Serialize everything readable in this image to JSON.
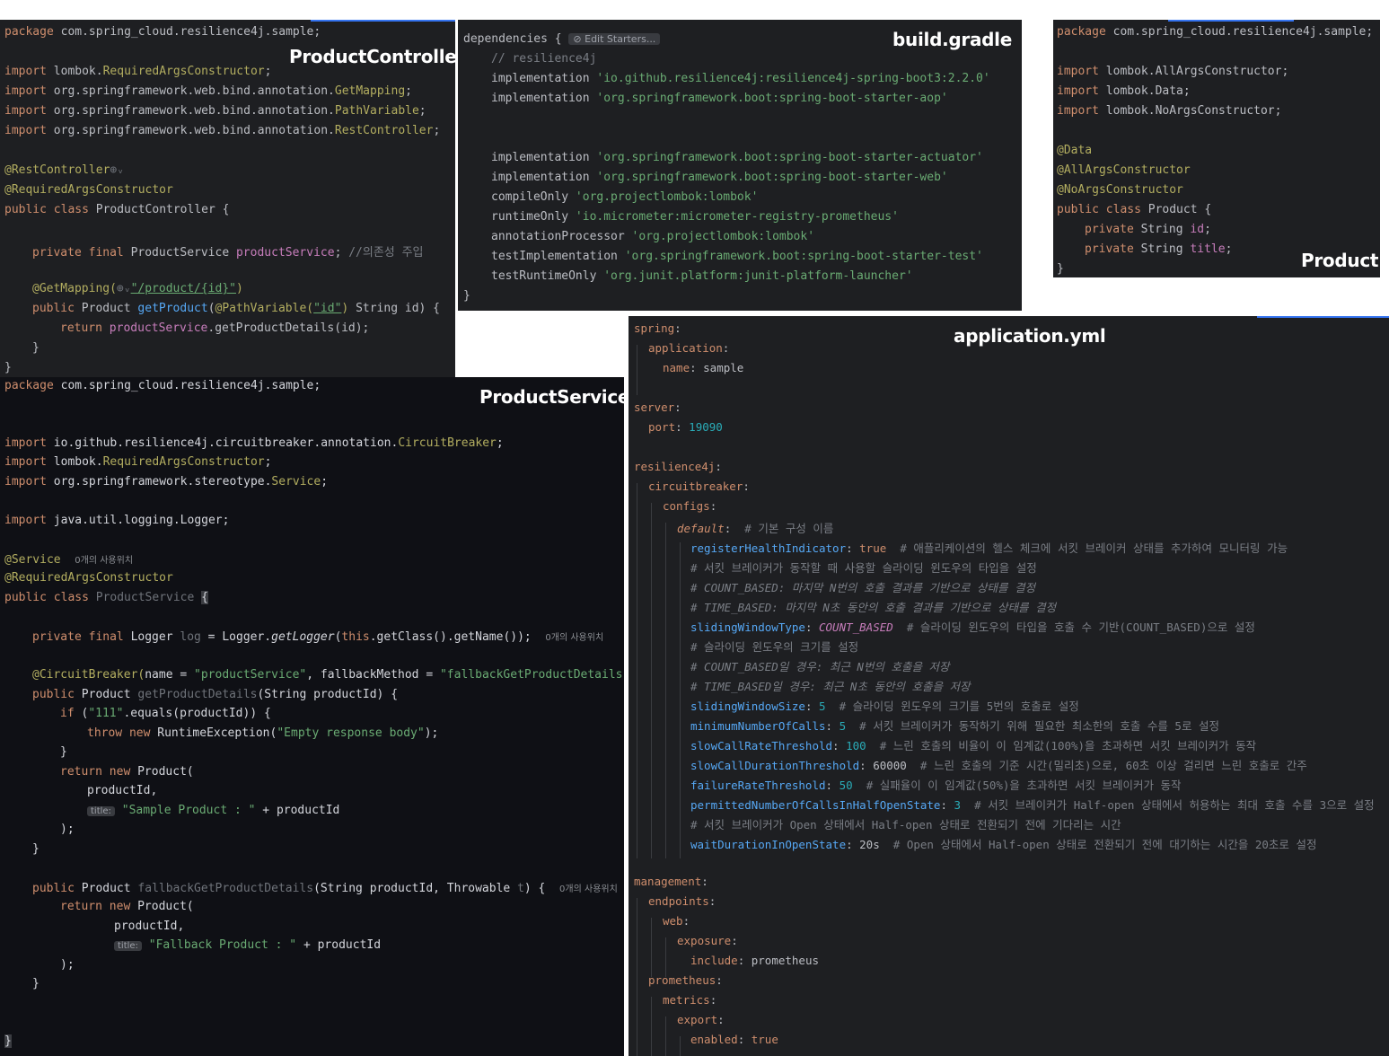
{
  "panels": {
    "controller": {
      "title": "ProductController",
      "lines": {
        "l01a": "package",
        "l01b": " com.spring_cloud.resilience4j.sample;",
        "l02a": "import",
        "l02b": " lombok.",
        "l02c": "RequiredArgsConstructor",
        "l02d": ";",
        "l03a": "import",
        "l03b": " org.springframework.web.bind.annotation.",
        "l03c": "GetMapping",
        "l03d": ";",
        "l04a": "import",
        "l04b": " org.springframework.web.bind.annotation.",
        "l04c": "PathVariable",
        "l04d": ";",
        "l05a": "import",
        "l05b": " org.springframework.web.bind.annotation.",
        "l05c": "RestController",
        "l05d": ";",
        "l06a": "@RestController",
        "l06b": "⊕ᵥ",
        "l07a": "@RequiredArgsConstructor",
        "l08a": "public class",
        "l08b": " ProductController {",
        "l09a": "private final",
        "l09b": " ProductService ",
        "l09c": "productService",
        "l09d": "; ",
        "l09e": "//의존성 주입",
        "l10a": "@GetMapping(",
        "l10b": "⊕ᵥ",
        "l10c": "\"/product/{id}\"",
        "l10d": ")",
        "l11a": "public",
        "l11b": " Product ",
        "l11c": "getProduct",
        "l11d": "(",
        "l11e": "@PathVariable(",
        "l11f": "\"id\"",
        "l11g": ")",
        "l11h": " String id) {",
        "l12a": "return",
        "l12b": " productService",
        "l12c": ".getProductDetails(id);",
        "l13a": "}",
        "l14a": "}"
      }
    },
    "gradle": {
      "title": "build.gradle",
      "edit_starters": "Edit Starters...",
      "lines": {
        "g01a": "dependencies {",
        "g02a": "// resilience4j",
        "g03a": "implementation",
        "g03b": "'io.github.resilience4j:resilience4j-spring-boot3:2.2.0'",
        "g04a": "implementation",
        "g04b": "'org.springframework.boot:spring-boot-starter-aop'",
        "g05a": "implementation",
        "g05b": "'org.springframework.boot:spring-boot-starter-actuator'",
        "g06a": "implementation",
        "g06b": "'org.springframework.boot:spring-boot-starter-web'",
        "g07a": "compileOnly",
        "g07b": "'org.projectlombok:lombok'",
        "g08a": "runtimeOnly",
        "g08b": "'io.micrometer:micrometer-registry-prometheus'",
        "g09a": "annotationProcessor",
        "g09b": "'org.projectlombok:lombok'",
        "g10a": "testImplementation",
        "g10b": "'org.springframework.boot:spring-boot-starter-test'",
        "g11a": "testRuntimeOnly",
        "g11b": "'org.junit.platform:junit-platform-launcher'",
        "g12a": "}"
      }
    },
    "product": {
      "title": "Product",
      "lines": {
        "p01a": "package",
        "p01b": " com.spring_cloud.resilience4j.sample;",
        "p02a": "import",
        "p02b": " lombok.AllArgsConstructor;",
        "p03a": "import",
        "p03b": " lombok.Data;",
        "p04a": "import",
        "p04b": " lombok.NoArgsConstructor;",
        "p05a": "@Data",
        "p06a": "@AllArgsConstructor",
        "p07a": "@NoArgsConstructor",
        "p08a": "public class",
        "p08b": " Product {",
        "p09a": "private",
        "p09b": " String ",
        "p09c": "id",
        "p09d": ";",
        "p10a": "private",
        "p10b": " String ",
        "p10c": "title",
        "p10d": ";",
        "p11a": "}"
      }
    },
    "service": {
      "title": "ProductService",
      "lines": {
        "s01a": "package",
        "s01b": " com.spring_cloud.resilience4j.sample;",
        "s02a": "import",
        "s02b": " io.github.resilience4j.circuitbreaker.annotation.",
        "s02c": "CircuitBreaker",
        "s02d": ";",
        "s03a": "import",
        "s03b": " lombok.",
        "s03c": "RequiredArgsConstructor",
        "s03d": ";",
        "s04a": "import",
        "s04b": " org.springframework.stereotype.",
        "s04c": "Service",
        "s04d": ";",
        "s05a": "import",
        "s05b": " java.util.logging.Logger;",
        "s06a": "@Service",
        "s06b": "0개의 사용위치",
        "s07a": "@RequiredArgsConstructor",
        "s08a": "public class",
        "s08b": " ProductService ",
        "s08c": "{",
        "s09a": "private final",
        "s09b": " Logger ",
        "s09c": "log",
        "s09d": " = Logger.",
        "s09e": "getLogger",
        "s09f": "(",
        "s09g": "this",
        "s09h": ".getClass().getName());",
        "s09i": "0개의 사용위치",
        "s10a": "@CircuitBreaker(",
        "s10b": "name = ",
        "s10c": "\"productService\"",
        "s10d": ", fallbackMethod = ",
        "s10e": "\"fallbackGetProductDetails\"",
        "s10f": ")",
        "s11a": "public",
        "s11b": " Product ",
        "s11c": "getProductDetails",
        "s11d": "(String productId) {",
        "s12a": "if",
        "s12b": " (",
        "s12c": "\"111\"",
        "s12d": ".equals(productId)) {",
        "s13a": "throw new",
        "s13b": " RuntimeException(",
        "s13c": "\"Empty response body\"",
        "s13d": ");",
        "s14a": "}",
        "s15a": "return new",
        "s15b": " Product(",
        "s16a": "productId,",
        "s17a": "title:",
        "s17b": "\"Sample Product : \"",
        "s17c": " + productId",
        "s18a": ");",
        "s19a": "}",
        "s20a": "public",
        "s20b": " Product ",
        "s20c": "fallbackGetProductDetails",
        "s20d": "(String productId, Throwable ",
        "s20e": "t",
        "s20f": ") {",
        "s20g": "0개의 사용위치",
        "s21a": "return new",
        "s21b": " Product(",
        "s22a": "productId,",
        "s23a": "title:",
        "s23b": "\"Fallback Product : \"",
        "s23c": " + productId",
        "s24a": ");",
        "s25a": "}",
        "s26a": "}"
      }
    },
    "yaml": {
      "title": "application.yml",
      "lines": {
        "y01a": "spring",
        "y01b": ":",
        "y02a": "application",
        "y02b": ":",
        "y03a": "name",
        "y03b": ": sample",
        "y04a": "server",
        "y04b": ":",
        "y05a": "port",
        "y05b": ": ",
        "y05c": "19090",
        "y06a": "resilience4j",
        "y06b": ":",
        "y07a": "circuitbreaker",
        "y07b": ":",
        "y08a": "configs",
        "y08b": ":",
        "y09a": "default",
        "y09b": ":  ",
        "y09c": "# 기본 구성 이름",
        "y10a": "registerHealthIndicator",
        "y10b": ": ",
        "y10c": "true",
        "y10d": "  # 애플리케이션의 헬스 체크에 서킷 브레이커 상태를 추가하여 모니터링 가능",
        "y11a": "# 서킷 브레이커가 동작할 때 사용할 슬라이딩 윈도우의 타입을 설정",
        "y12a": "# COUNT_BASED: 마지막 N번의 호출 결과를 기반으로 상태를 결정",
        "y13a": "# TIME_BASED: 마지막 N초 동안의 호출 결과를 기반으로 상태를 결정",
        "y14a": "slidingWindowType",
        "y14b": ": ",
        "y14c": "COUNT_BASED",
        "y14d": "  # 슬라이딩 윈도우의 타입을 호출 수 기반(COUNT_BASED)으로 설정",
        "y15a": "# 슬라이딩 윈도우의 크기를 설정",
        "y16a": "# COUNT_BASED일 경우: 최근 N번의 호출을 저장",
        "y17a": "# TIME_BASED일 경우: 최근 N초 동안의 호출을 저장",
        "y18a": "slidingWindowSize",
        "y18b": ": ",
        "y18c": "5",
        "y18d": "  # 슬라이딩 윈도우의 크기를 5번의 호출로 설정",
        "y19a": "minimumNumberOfCalls",
        "y19b": ": ",
        "y19c": "5",
        "y19d": "  # 서킷 브레이커가 동작하기 위해 필요한 최소한의 호출 수를 5로 설정",
        "y20a": "slowCallRateThreshold",
        "y20b": ": ",
        "y20c": "100",
        "y20d": "  # 느린 호출의 비율이 이 임계값(100%)을 초과하면 서킷 브레이커가 동작",
        "y21a": "slowCallDurationThreshold",
        "y21b": ": 60000",
        "y21d": "  # 느린 호출의 기준 시간(밀리초)으로, 60초 이상 걸리면 느린 호출로 간주",
        "y22a": "failureRateThreshold",
        "y22b": ": ",
        "y22c": "50",
        "y22d": "  # 실패율이 이 임계값(50%)을 초과하면 서킷 브레이커가 동작",
        "y23a": "permittedNumberOfCallsInHalfOpenState",
        "y23b": ": ",
        "y23c": "3",
        "y23d": "  # 서킷 브레이커가 Half-open 상태에서 허용하는 최대 호출 수를 3으로 설정",
        "y24a": "# 서킷 브레이커가 Open 상태에서 Half-open 상태로 전환되기 전에 기다리는 시간",
        "y25a": "waitDurationInOpenState",
        "y25b": ": 20s",
        "y25d": "  # Open 상태에서 Half-open 상태로 전환되기 전에 대기하는 시간을 20초로 설정",
        "y26a": "management",
        "y26b": ":",
        "y27a": "endpoints",
        "y27b": ":",
        "y28a": "web",
        "y28b": ":",
        "y29a": "exposure",
        "y29b": ":",
        "y30a": "include",
        "y30b": ": prometheus",
        "y31a": "prometheus",
        "y31b": ":",
        "y32a": "metrics",
        "y32b": ":",
        "y33a": "export",
        "y33b": ":",
        "y34a": "enabled",
        "y34b": ": ",
        "y34c": "true"
      }
    }
  },
  "colors": {
    "editor_bg": "#1e1f22",
    "service_bg": "#0f1015",
    "keyword": "#cf8e6d",
    "annotation": "#b3ae60",
    "string": "#6aab73",
    "function": "#56a8f5",
    "field": "#c77dbb",
    "comment": "#7a7e85",
    "number": "#2aacb8",
    "title": "#ffffff"
  }
}
